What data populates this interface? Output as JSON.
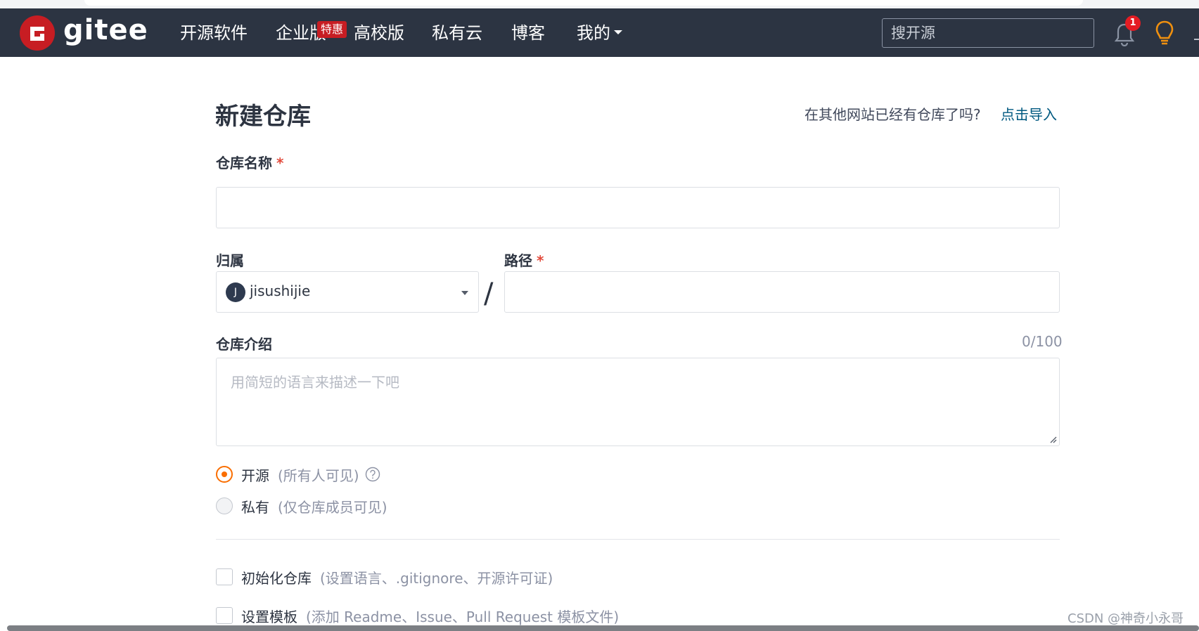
{
  "navbar": {
    "logo_text": "gitee",
    "items": [
      {
        "label": "开源软件"
      },
      {
        "label": "企业版"
      },
      {
        "label": "高校版"
      },
      {
        "label": "私有云"
      },
      {
        "label": "博客"
      },
      {
        "label": "我的"
      }
    ],
    "promo_badge": "特惠",
    "search_placeholder": "搜开源",
    "notification_count": "1",
    "accent_color": "#c71d23"
  },
  "page": {
    "title": "新建仓库",
    "import_prompt": "在其他网站已经有仓库了吗?",
    "import_link": "点击导入"
  },
  "form": {
    "repo_name_label": "仓库名称",
    "required_mark": "*",
    "repo_name_value": "",
    "owner_label": "归属",
    "owner_avatar_letter": "J",
    "owner_value": "jisushijie",
    "path_label": "路径",
    "path_value": "",
    "separator": "/",
    "description_label": "仓库介绍",
    "description_counter": "0/100",
    "description_placeholder": "用简短的语言来描述一下吧",
    "visibility": [
      {
        "label": "开源",
        "hint": "(所有人可见)",
        "checked": true
      },
      {
        "label": "私有",
        "hint": "(仅仓库成员可见)",
        "checked": false
      }
    ],
    "options": [
      {
        "label": "初始化仓库",
        "hint": "(设置语言、.gitignore、开源许可证)",
        "checked": false
      },
      {
        "label": "设置模板",
        "hint": "(添加 Readme、Issue、Pull Request 模板文件)",
        "checked": false
      }
    ],
    "radio_accent": "#fa6e00"
  },
  "watermark": "CSDN @神奇小永哥"
}
